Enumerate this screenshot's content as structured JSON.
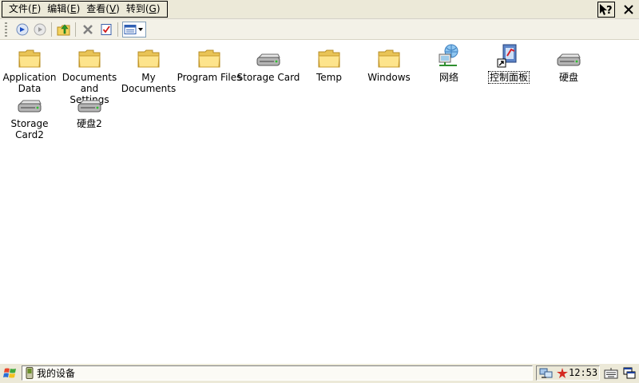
{
  "menubar": {
    "items": [
      {
        "label": "文件(",
        "key": "F",
        "end": ")"
      },
      {
        "label": "编辑(",
        "key": "E",
        "end": ")"
      },
      {
        "label": "查看(",
        "key": "V",
        "end": ")"
      },
      {
        "label": "转到(",
        "key": "G",
        "end": ")"
      }
    ],
    "help_icon": "help-question-icon",
    "close_icon": "close-icon"
  },
  "toolbar": {
    "icons": [
      "back-arrow-icon",
      "forward-arrow-icon",
      "up-folder-icon",
      "delete-x-icon",
      "properties-icon",
      "view-mode-icon"
    ]
  },
  "files": [
    {
      "line1": "Application",
      "line2": "Data",
      "icon": "folder-icon"
    },
    {
      "line1": "Documents",
      "line2": "and Settings",
      "icon": "folder-icon"
    },
    {
      "line1": "My",
      "line2": "Documents",
      "icon": "folder-icon"
    },
    {
      "line1": "Program Files",
      "line2": "",
      "icon": "folder-icon"
    },
    {
      "line1": "Storage Card",
      "line2": "",
      "icon": "drive-icon"
    },
    {
      "line1": "Temp",
      "line2": "",
      "icon": "folder-icon"
    },
    {
      "line1": "Windows",
      "line2": "",
      "icon": "folder-icon"
    },
    {
      "line1": "网络",
      "line2": "",
      "icon": "network-icon"
    },
    {
      "line1": "控制面板",
      "line2": "",
      "icon": "control-panel-shortcut-icon"
    },
    {
      "line1": "硬盘",
      "line2": "",
      "icon": "drive-icon"
    },
    {
      "line1": "Storage",
      "line2": "Card2",
      "icon": "drive-icon"
    },
    {
      "line1": "硬盘2",
      "line2": "",
      "icon": "drive-icon"
    }
  ],
  "taskbar": {
    "window_title": "我的设备",
    "clock": "12:53"
  }
}
